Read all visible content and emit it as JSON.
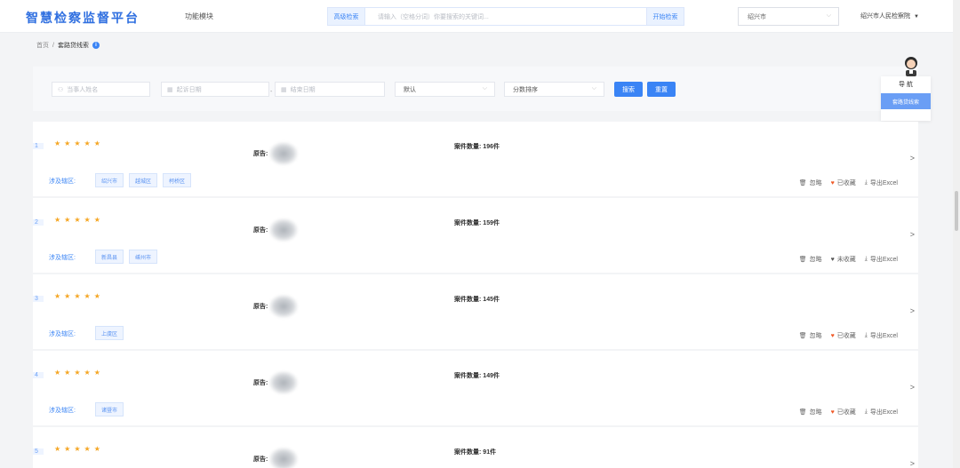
{
  "header": {
    "logo": "智慧检察监督平台",
    "func_menu": "功能模块",
    "adv_search": "高级检索",
    "search_placeholder": "请输入（空格分词）你要搜索的关键词...",
    "start_search": "开始检索",
    "city": "绍兴市",
    "org": "绍兴市人民检察院"
  },
  "breadcrumb": {
    "home": "首页",
    "sep": "/",
    "current": "套路贷线索"
  },
  "filters": {
    "party_placeholder": "当事人姓名",
    "start_date_placeholder": "起诉日期",
    "dash": "-",
    "end_date_placeholder": "结束日期",
    "sort_default": "默认",
    "score_sort": "分数排序",
    "search_btn": "搜索",
    "reset_btn": "重置"
  },
  "float_nav": {
    "title": "导 航",
    "item": "套路贷线索"
  },
  "labels": {
    "plaintiff": "原告:",
    "cases_prefix": "案件数量:",
    "region": "涉及辖区:",
    "ignore": "忽略",
    "export": "导出Excel"
  },
  "cards": [
    {
      "index": "1",
      "stars": "★★★★★",
      "cases": "196件",
      "fav": "已收藏",
      "fav_state": "collected",
      "tags": [
        "绍兴市",
        "越城区",
        "柯桥区"
      ]
    },
    {
      "index": "2",
      "stars": "★★★★★",
      "cases": "159件",
      "fav": "未收藏",
      "fav_state": "not-collected",
      "tags": [
        "新昌县",
        "嵊州市"
      ]
    },
    {
      "index": "3",
      "stars": "★★★★★",
      "cases": "145件",
      "fav": "已收藏",
      "fav_state": "collected",
      "tags": [
        "上虞区"
      ]
    },
    {
      "index": "4",
      "stars": "★★★★★",
      "cases": "149件",
      "fav": "已收藏",
      "fav_state": "collected",
      "tags": [
        "诸暨市"
      ]
    },
    {
      "index": "5",
      "stars": "★★★★★",
      "cases": "91件",
      "fav": "",
      "fav_state": "",
      "tags": []
    }
  ],
  "colors": {
    "primary": "#3a84f5",
    "star": "#f5a623",
    "heart": "#f05a28"
  }
}
